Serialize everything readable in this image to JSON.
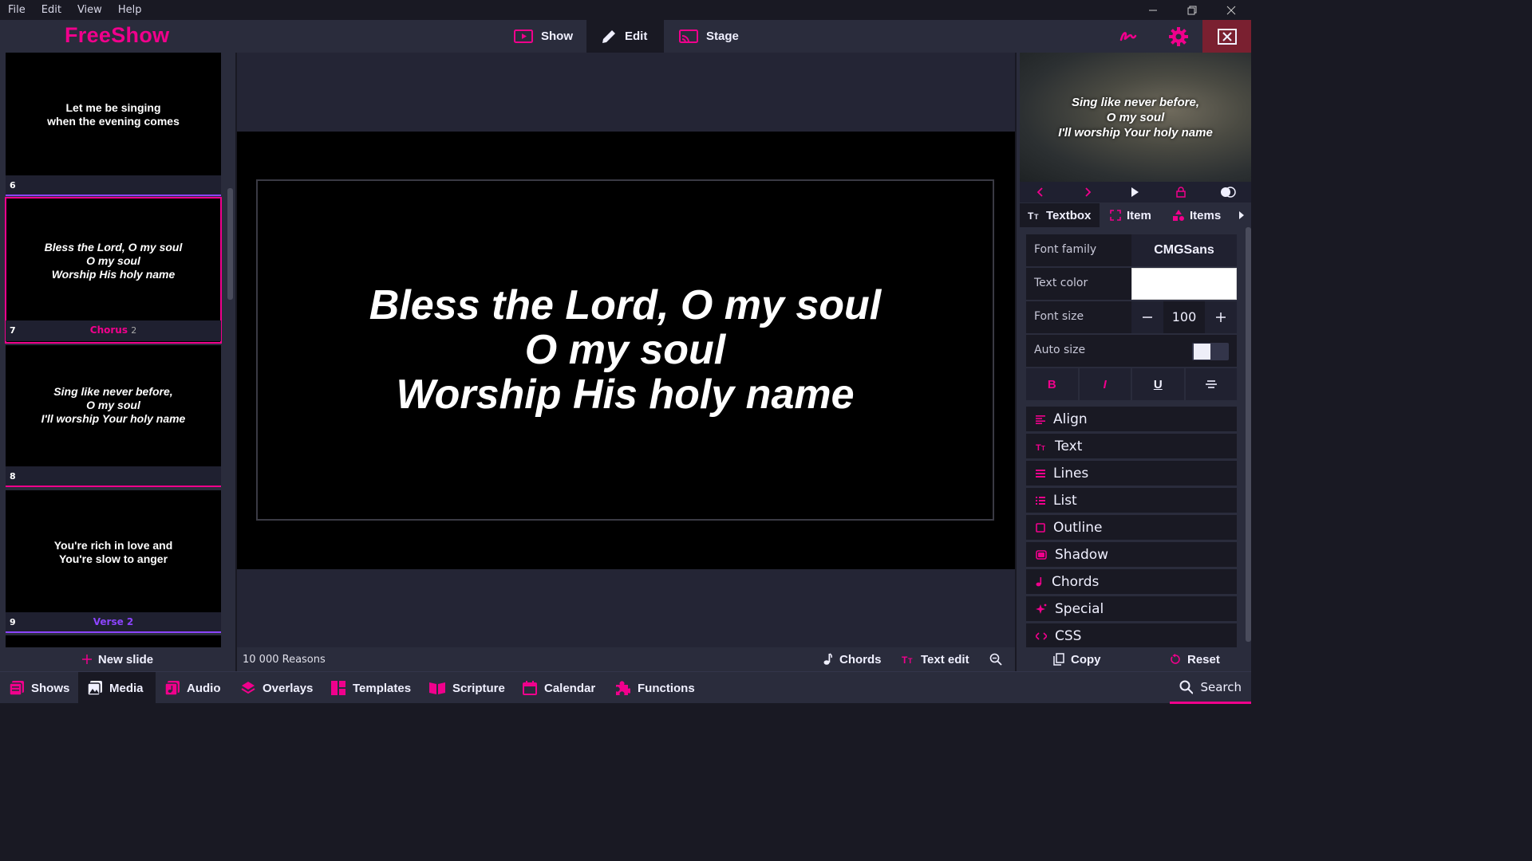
{
  "menubar": {
    "items": [
      "File",
      "Edit",
      "View",
      "Help"
    ]
  },
  "app": {
    "name": "FreeShow"
  },
  "modes": {
    "show": "Show",
    "edit": "Edit",
    "stage": "Stage"
  },
  "slides": [
    {
      "number": "6",
      "lines": [
        "Let me be singing",
        "when the evening comes"
      ],
      "group": "",
      "group_count": ""
    },
    {
      "number": "7",
      "lines": [
        "Bless the Lord, O my soul",
        "O my soul",
        "Worship His holy name"
      ],
      "group": "Chorus",
      "group_count": "2"
    },
    {
      "number": "8",
      "lines": [
        "Sing like never before,",
        "O my soul",
        "I'll worship Your holy name"
      ],
      "group": "",
      "group_count": ""
    },
    {
      "number": "9",
      "lines": [
        "You're rich in love and",
        "You're slow to anger"
      ],
      "group": "Verse 2",
      "group_count": ""
    }
  ],
  "new_slide_label": "New slide",
  "editor": {
    "lines": [
      "Bless the Lord, O my soul",
      "O my soul",
      "Worship His holy name"
    ],
    "show_name": "10 000 Reasons",
    "chords_label": "Chords",
    "text_edit_label": "Text edit"
  },
  "preview": {
    "lines": [
      "Sing like never before,",
      "O my soul",
      "I'll worship Your holy name"
    ]
  },
  "tabs": {
    "textbox": "Textbox",
    "item": "Item",
    "items": "Items"
  },
  "props": {
    "font_family_label": "Font family",
    "font_family_value": "CMGSans",
    "text_color_label": "Text color",
    "text_color_value": "#ffffff",
    "font_size_label": "Font size",
    "font_size_value": "100",
    "auto_size_label": "Auto size",
    "auto_size_on": false,
    "format_buttons": [
      "B",
      "I",
      "U"
    ]
  },
  "sections": [
    "Align",
    "Text",
    "Lines",
    "List",
    "Outline",
    "Shadow",
    "Chords",
    "Special",
    "CSS"
  ],
  "right_actions": {
    "copy": "Copy",
    "reset": "Reset"
  },
  "bottom_nav": [
    "Shows",
    "Media",
    "Audio",
    "Overlays",
    "Templates",
    "Scripture",
    "Calendar",
    "Functions"
  ],
  "search_label": "Search",
  "colors": {
    "accent": "#f0008c",
    "verse": "#8c44ff",
    "background": "#191923",
    "panel": "#2a2c3c"
  }
}
